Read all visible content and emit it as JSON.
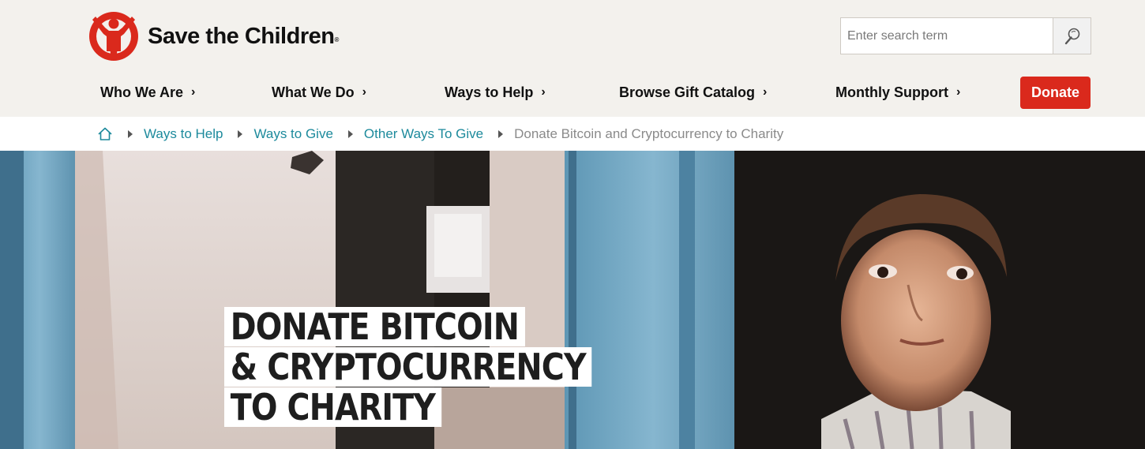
{
  "brand": {
    "name": "Save the Children",
    "trademark": "®",
    "color": "#da291c"
  },
  "search": {
    "placeholder": "Enter search term",
    "icon": "magnifier-icon"
  },
  "nav": {
    "items": [
      {
        "label": "Who We Are",
        "chevron": "›"
      },
      {
        "label": "What We Do",
        "chevron": "›"
      },
      {
        "label": "Ways to Help",
        "chevron": "›"
      },
      {
        "label": "Browse Gift Catalog",
        "chevron": "›"
      },
      {
        "label": "Monthly Support",
        "chevron": "›"
      }
    ],
    "donate_label": "Donate"
  },
  "breadcrumb": {
    "home_icon": "home-icon",
    "links": [
      "Ways to Help",
      "Ways to Give",
      "Other Ways To Give"
    ],
    "current": "Donate Bitcoin and Cryptocurrency to Charity",
    "link_color": "#1d8a9c"
  },
  "hero": {
    "title_lines": [
      "DONATE BITCOIN",
      "& CRYPTOCURRENCY",
      "TO CHARITY"
    ]
  }
}
